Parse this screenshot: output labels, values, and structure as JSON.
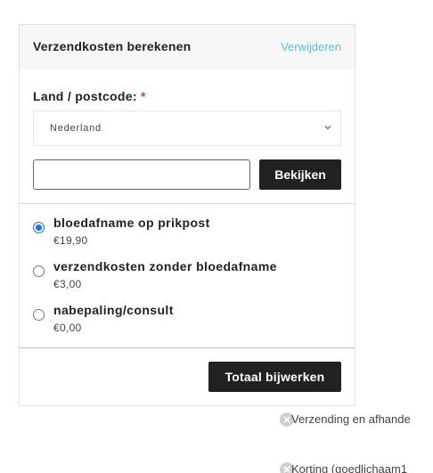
{
  "shipping_calculator": {
    "title": "Verzendkosten berekenen",
    "remove_label": "Verwijderen",
    "country_label": "Land / postcode:",
    "required_marker": "*",
    "country_value": "Nederland",
    "postcode_value": "",
    "view_button": "Bekijken"
  },
  "shipping_options": [
    {
      "name": "bloedafname op prikpost",
      "price": "€19,90",
      "selected": true
    },
    {
      "name": "verzendkosten zonder bloedafname",
      "price": "€3,00",
      "selected": false
    },
    {
      "name": "nabepaling/consult",
      "price": "€0,00",
      "selected": false
    }
  ],
  "update_button": "Totaal bijwerken",
  "side_items": [
    {
      "label": "Verzending en afhande"
    },
    {
      "label": "Korting (goedlichaam1"
    }
  ],
  "colors": {
    "accent_link": "#5bc0de",
    "button_bg": "#212121",
    "radio_selected": "#1a73e8",
    "required": "#e2401c"
  }
}
